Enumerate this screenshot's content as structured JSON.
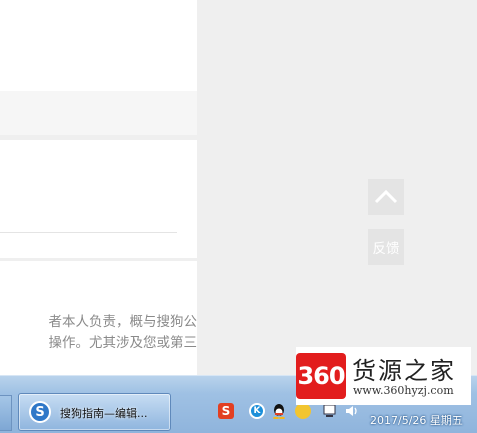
{
  "article": {
    "disclaimer_line1": "者本人负责，概与搜狗公",
    "disclaimer_line2": "操作。尤其涉及您或第三"
  },
  "side_buttons": {
    "top_icon": "chevron-up-icon",
    "feedback_label": "反馈"
  },
  "taskbar": {
    "task_button_label": "搜狗指南—编辑...",
    "task_icon_letter": "S",
    "tray_icons": [
      "sogou-input-icon",
      "k-icon",
      "qq-icon",
      "security-icon",
      "network-flag-icon",
      "volume-icon"
    ],
    "tray_sogou_letter": "S",
    "tray_k_letter": "K",
    "clock": "2017/5/26 星期五"
  },
  "watermark": {
    "badge": "360",
    "name": "货源之家",
    "url": "www.360hyzj.com"
  },
  "colors": {
    "page_bg": "#efefef",
    "card_bg": "#ffffff",
    "logo_red": "#e21d1d",
    "taskbar_blue": "#9fc1e4"
  }
}
